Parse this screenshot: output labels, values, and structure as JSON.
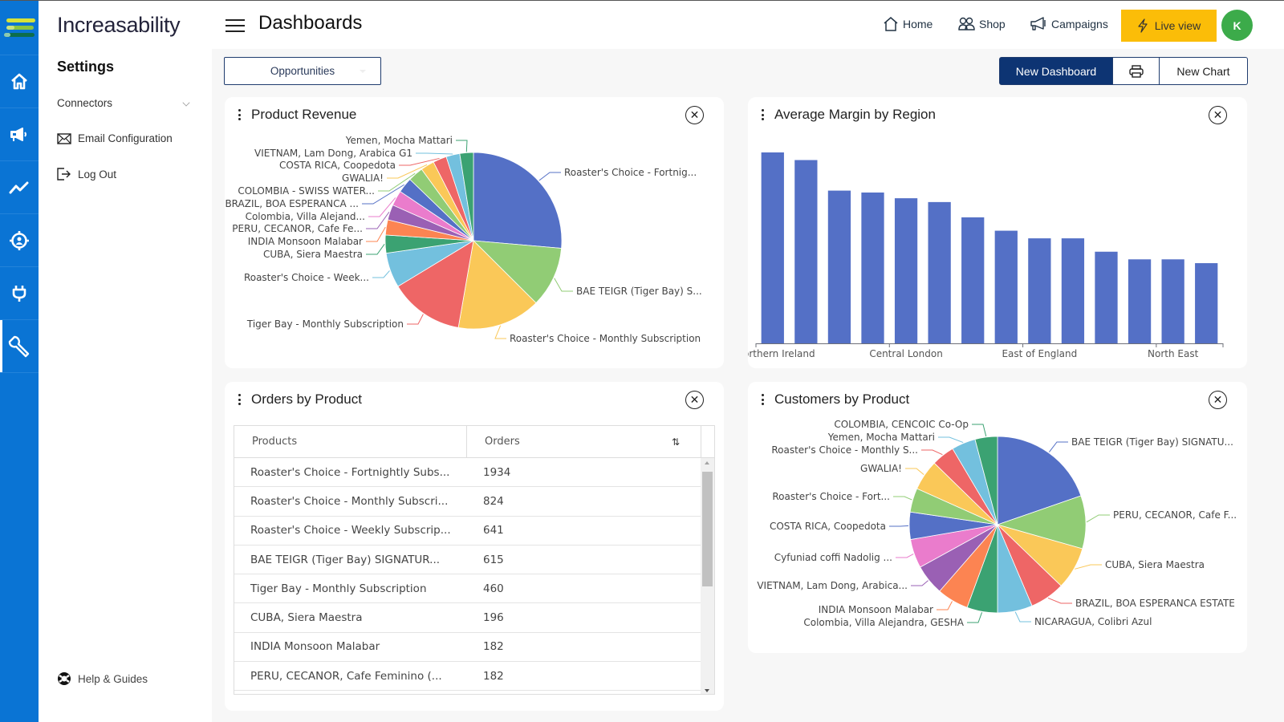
{
  "app": {
    "brand": "Increasability"
  },
  "rail": {
    "items": [
      {
        "icon": "home-icon"
      },
      {
        "icon": "megaphone-icon"
      },
      {
        "icon": "trend-line-icon"
      },
      {
        "icon": "target-user-icon"
      },
      {
        "icon": "plug-icon"
      },
      {
        "icon": "wrench-icon",
        "active": true
      }
    ]
  },
  "sidebar": {
    "heading": "Settings",
    "items": [
      {
        "label": "Connectors",
        "icon": "chevron-down-icon"
      },
      {
        "label": "Email Configuration",
        "icon": "envelope-icon"
      },
      {
        "label": "Log Out",
        "icon": "logout-icon"
      }
    ],
    "help": {
      "label": "Help & Guides",
      "icon": "lifebuoy-icon"
    }
  },
  "header": {
    "title": "Dashboards",
    "nav": [
      {
        "label": "Home",
        "icon": "home-outline-icon"
      },
      {
        "label": "Shop",
        "icon": "users-icon"
      },
      {
        "label": "Campaigns",
        "icon": "megaphone-outline-icon"
      }
    ],
    "live_view": "Live view",
    "avatar_initial": "K",
    "colors": {
      "live": "#fbbd08",
      "avatar": "#3cab4a",
      "rail": "#0a74d4",
      "primary": "#0d3473"
    }
  },
  "toolbar": {
    "dashboard_select": "Opportunities",
    "new_dashboard": "New Dashboard",
    "new_chart": "New Chart"
  },
  "chart_data": [
    {
      "title": "Product Revenue",
      "type": "pie",
      "units": "approx. share of total (%)",
      "slices": [
        {
          "label": "Roaster's Choice - Fortnig...",
          "value": 26.4,
          "color": "#5470c6"
        },
        {
          "label": "BAE TEIGR (Tiger Bay)  S...",
          "value": 11.1,
          "color": "#91cc75"
        },
        {
          "label": "Roaster's Choice - Monthly Subscription",
          "value": 15.3,
          "color": "#fac858"
        },
        {
          "label": "Tiger Bay - Monthly Subscription",
          "value": 13.6,
          "color": "#ee6666"
        },
        {
          "label": "Roaster's Choice - Week...",
          "value": 6.4,
          "color": "#73c0de"
        },
        {
          "label": "CUBA, Siera Maestra",
          "value": 3.3,
          "color": "#3ba272"
        },
        {
          "label": "INDIA Monsoon Malabar",
          "value": 2.8,
          "color": "#fc8452"
        },
        {
          "label": "PERU, CECANOR, Cafe Fe...",
          "value": 2.8,
          "color": "#9a60b4"
        },
        {
          "label": "Colombia, Villa Alejand...",
          "value": 2.8,
          "color": "#ea7ccc"
        },
        {
          "label": "BRAZIL, BOA ESPERANCA ...",
          "value": 2.8,
          "color": "#5470c6"
        },
        {
          "label": "COLOMBIA - SWISS WATER...",
          "value": 2.8,
          "color": "#91cc75"
        },
        {
          "label": "GWALIA!",
          "value": 2.5,
          "color": "#fac858"
        },
        {
          "label": "COSTA RICA, Coopedota",
          "value": 2.5,
          "color": "#ee6666"
        },
        {
          "label": "VIETNAM, Lam Dong, Arabica G1",
          "value": 2.5,
          "color": "#73c0de"
        },
        {
          "label": "Yemen, Mocha Mattari",
          "value": 2.5,
          "color": "#3ba272"
        }
      ]
    },
    {
      "title": "Average Margin by Region",
      "type": "bar",
      "units": "relative (no axis scale shown)",
      "categories": [
        "Northern Ireland",
        "",
        "",
        "",
        "Central London",
        "",
        "",
        "",
        "East of England",
        "",
        "",
        "",
        "North East",
        ""
      ],
      "tick_labels": [
        "orthern Ireland",
        "Central London",
        "East of England",
        "North East"
      ],
      "values": [
        100,
        96,
        80,
        79,
        76,
        74,
        66,
        59,
        55,
        55,
        48,
        44,
        44,
        42
      ],
      "ylim": [
        0,
        100
      ],
      "color": "#5470c6",
      "grid": false
    },
    {
      "title": "Orders by Product",
      "type": "table",
      "columns": [
        "Products",
        "Orders"
      ],
      "rows": [
        [
          "Roaster's Choice - Fortnightly Subs...",
          "1934"
        ],
        [
          "Roaster's Choice - Monthly Subscri...",
          "824"
        ],
        [
          "Roaster's Choice - Weekly Subscrip...",
          "641"
        ],
        [
          "BAE TEIGR (Tiger Bay) SIGNATUR...",
          "615"
        ],
        [
          "Tiger Bay - Monthly Subscription",
          "460"
        ],
        [
          "CUBA, Siera Maestra",
          "196"
        ],
        [
          "INDIA Monsoon Malabar",
          "182"
        ],
        [
          "PERU, CECANOR, Cafe Feminino (...",
          "182"
        ]
      ],
      "sort_icon": "sort-icon"
    },
    {
      "title": "Customers by Product",
      "type": "pie",
      "units": "approx. share of total (%)",
      "slices": [
        {
          "label": "BAE TEIGR (Tiger Bay)  SIGNATU...",
          "value": 19.7,
          "color": "#5470c6"
        },
        {
          "label": "PERU, CECANOR, Cafe F...",
          "value": 9.7,
          "color": "#91cc75"
        },
        {
          "label": "CUBA, Siera Maestra",
          "value": 7.8,
          "color": "#fac858"
        },
        {
          "label": "BRAZIL, BOA ESPERANCA ESTATE",
          "value": 6.4,
          "color": "#ee6666"
        },
        {
          "label": "NICARAGUA,  Colibri Azul",
          "value": 6.4,
          "color": "#73c0de"
        },
        {
          "label": "Colombia, Villa Alejandra, GESHA",
          "value": 5.6,
          "color": "#3ba272"
        },
        {
          "label": "INDIA Monsoon Malabar",
          "value": 5.8,
          "color": "#fc8452"
        },
        {
          "label": "VIETNAM, Lam Dong, Arabica...",
          "value": 5.6,
          "color": "#9a60b4"
        },
        {
          "label": "Cyfuniad coffi Nadolig ...",
          "value": 5.3,
          "color": "#ea7ccc"
        },
        {
          "label": "COSTA RICA, Coopedota",
          "value": 5.0,
          "color": "#5470c6"
        },
        {
          "label": "Roaster's Choice - Fort...",
          "value": 4.4,
          "color": "#91cc75"
        },
        {
          "label": "GWALIA!",
          "value": 5.6,
          "color": "#fac858"
        },
        {
          "label": "Roaster's Choice - Monthly S...",
          "value": 4.2,
          "color": "#ee6666"
        },
        {
          "label": "Yemen, Mocha Mattari",
          "value": 4.4,
          "color": "#73c0de"
        },
        {
          "label": "COLOMBIA, CENCOIC Co-Op",
          "value": 4.1,
          "color": "#3ba272"
        }
      ]
    }
  ]
}
